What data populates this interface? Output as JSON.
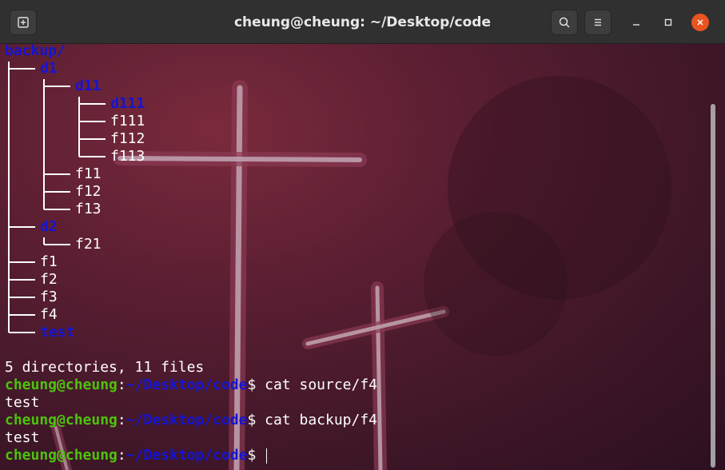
{
  "window": {
    "title": "cheung@cheung: ~/Desktop/code"
  },
  "icons": {
    "new_tab": "new-tab-icon",
    "search": "search-icon",
    "menu": "hamburger-menu-icon",
    "minimize": "minimize-icon",
    "maximize": "maximize-icon",
    "close": "close-icon"
  },
  "colors": {
    "directory": "#1414d4",
    "user_host": "#4ec20c",
    "close_button": "#e95420"
  },
  "tree": {
    "root": "backup/",
    "d1": "d1",
    "d11": "d11",
    "d111": "d111",
    "f111": "f111",
    "f112": "f112",
    "f113": "f113",
    "f11": "f11",
    "f12": "f12",
    "f13": "f13",
    "d2": "d2",
    "f21": "f21",
    "f1": "f1",
    "f2": "f2",
    "f3": "f3",
    "f4": "f4",
    "test": "test"
  },
  "summary": "5 directories, 11 files",
  "prompt": {
    "user_host": "cheung@cheung",
    "colon": ":",
    "path": "~/Desktop/code",
    "dollar": "$"
  },
  "commands": [
    {
      "cmd": " cat source/f4",
      "output": "test"
    },
    {
      "cmd": " cat backup/f4",
      "output": "test"
    },
    {
      "cmd": " "
    }
  ]
}
